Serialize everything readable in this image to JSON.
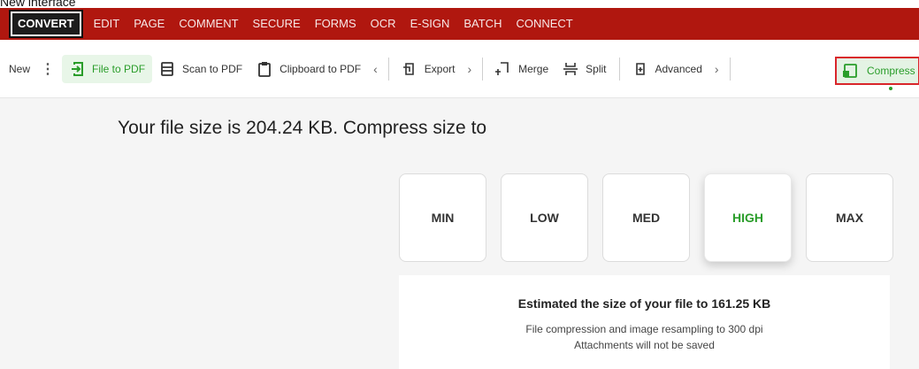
{
  "caption": "New interface",
  "menubar": {
    "items": [
      "CONVERT",
      "EDIT",
      "PAGE",
      "COMMENT",
      "SECURE",
      "FORMS",
      "OCR",
      "E-SIGN",
      "BATCH",
      "CONNECT"
    ]
  },
  "toolbar": {
    "new_label": "New",
    "more_glyph": "⋮",
    "file_to_pdf": "File to PDF",
    "scan_to_pdf": "Scan to PDF",
    "clipboard_to_pdf": "Clipboard to PDF",
    "prev_glyph": "‹",
    "export": "Export",
    "next_glyph": "›",
    "merge": "Merge",
    "split": "Split",
    "advanced": "Advanced",
    "compress": "Compress"
  },
  "main": {
    "headline": "Your file size is 204.24 KB. Compress size to",
    "levels": [
      "MIN",
      "LOW",
      "MED",
      "HIGH",
      "MAX"
    ],
    "selected_level": "HIGH",
    "estimate_text": "Estimated the size of your file to 161.25 KB",
    "note_line1": "File compression and image resampling to 300 dpi",
    "note_line2": "Attachments will not be saved"
  },
  "colors": {
    "menubar": "#b0170f",
    "accent_green": "#2a9d2a",
    "highlight_red": "#d9262b"
  }
}
